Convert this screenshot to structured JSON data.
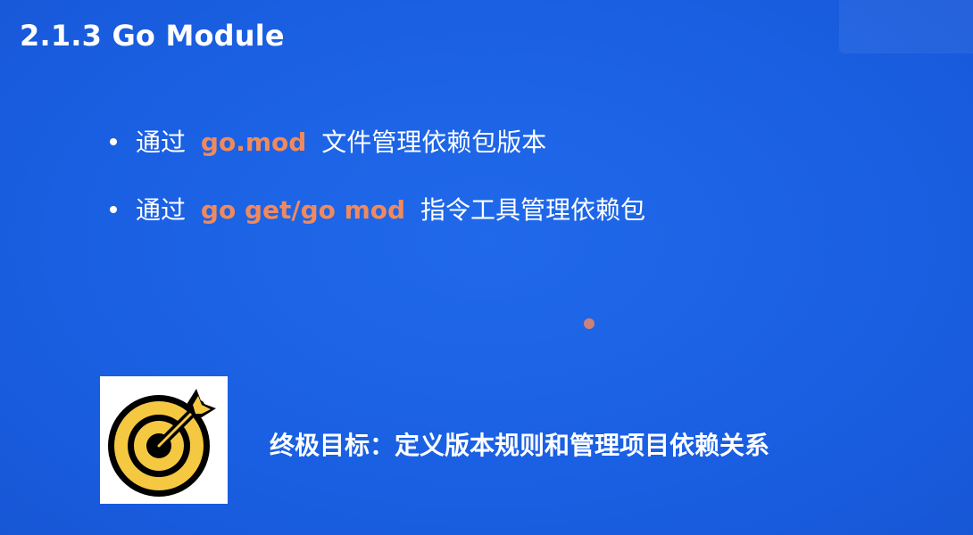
{
  "slide": {
    "title": "2.1.3 Go Module",
    "bullets": [
      {
        "prefix": "通过",
        "code": "go.mod",
        "suffix": "文件管理依赖包版本"
      },
      {
        "prefix": "通过",
        "code": "go get/go mod",
        "suffix": "指令工具管理依赖包"
      }
    ],
    "goal": "终极目标：定义版本规则和管理项目依赖关系",
    "icon": "target-icon"
  },
  "colors": {
    "background": "#1a5fe2",
    "highlight": "#f08a5d",
    "icon_fill": "#f5c842"
  }
}
